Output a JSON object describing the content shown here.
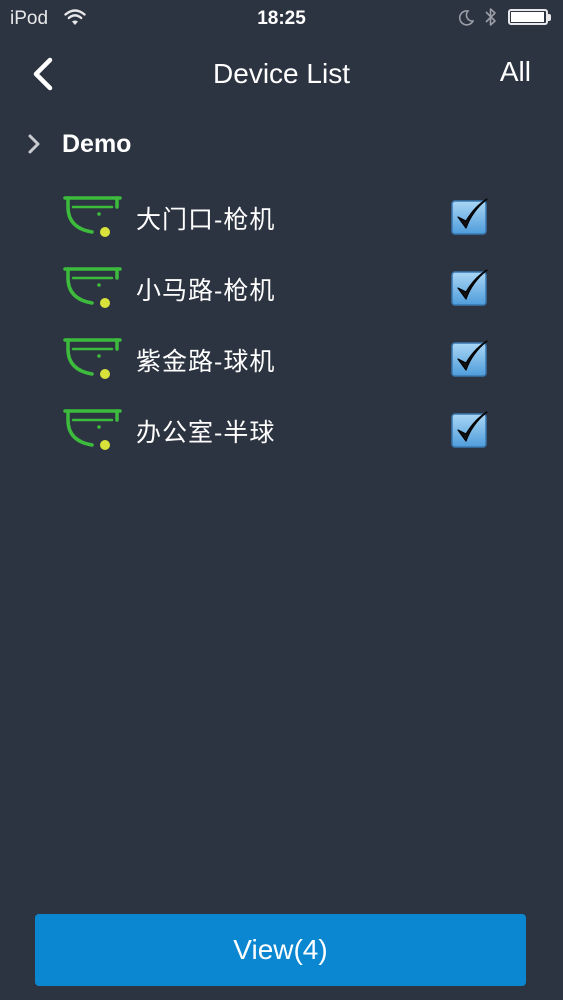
{
  "status_bar": {
    "carrier": "iPod",
    "time": "18:25",
    "battery_level": 0.97,
    "icons": [
      "wifi-icon",
      "moon-icon",
      "bluetooth-icon",
      "battery-icon"
    ]
  },
  "nav": {
    "title": "Device List",
    "back_icon": "chevron-left-icon",
    "all_label": "All"
  },
  "group": {
    "name": "Demo",
    "expand_icon": "chevron-right-icon"
  },
  "devices": [
    {
      "name": "大门口-枪机",
      "checked": true
    },
    {
      "name": "小马路-枪机",
      "checked": true
    },
    {
      "name": "紫金路-球机",
      "checked": true
    },
    {
      "name": "办公室-半球",
      "checked": true
    }
  ],
  "view_button": {
    "label": "View(4)"
  },
  "colors": {
    "background": "#2d3441",
    "accent": "#0b87d1",
    "camera_green": "#3dbb3d",
    "camera_dot": "#d8e23a",
    "checkbox_blue": "#6fb4e8"
  }
}
